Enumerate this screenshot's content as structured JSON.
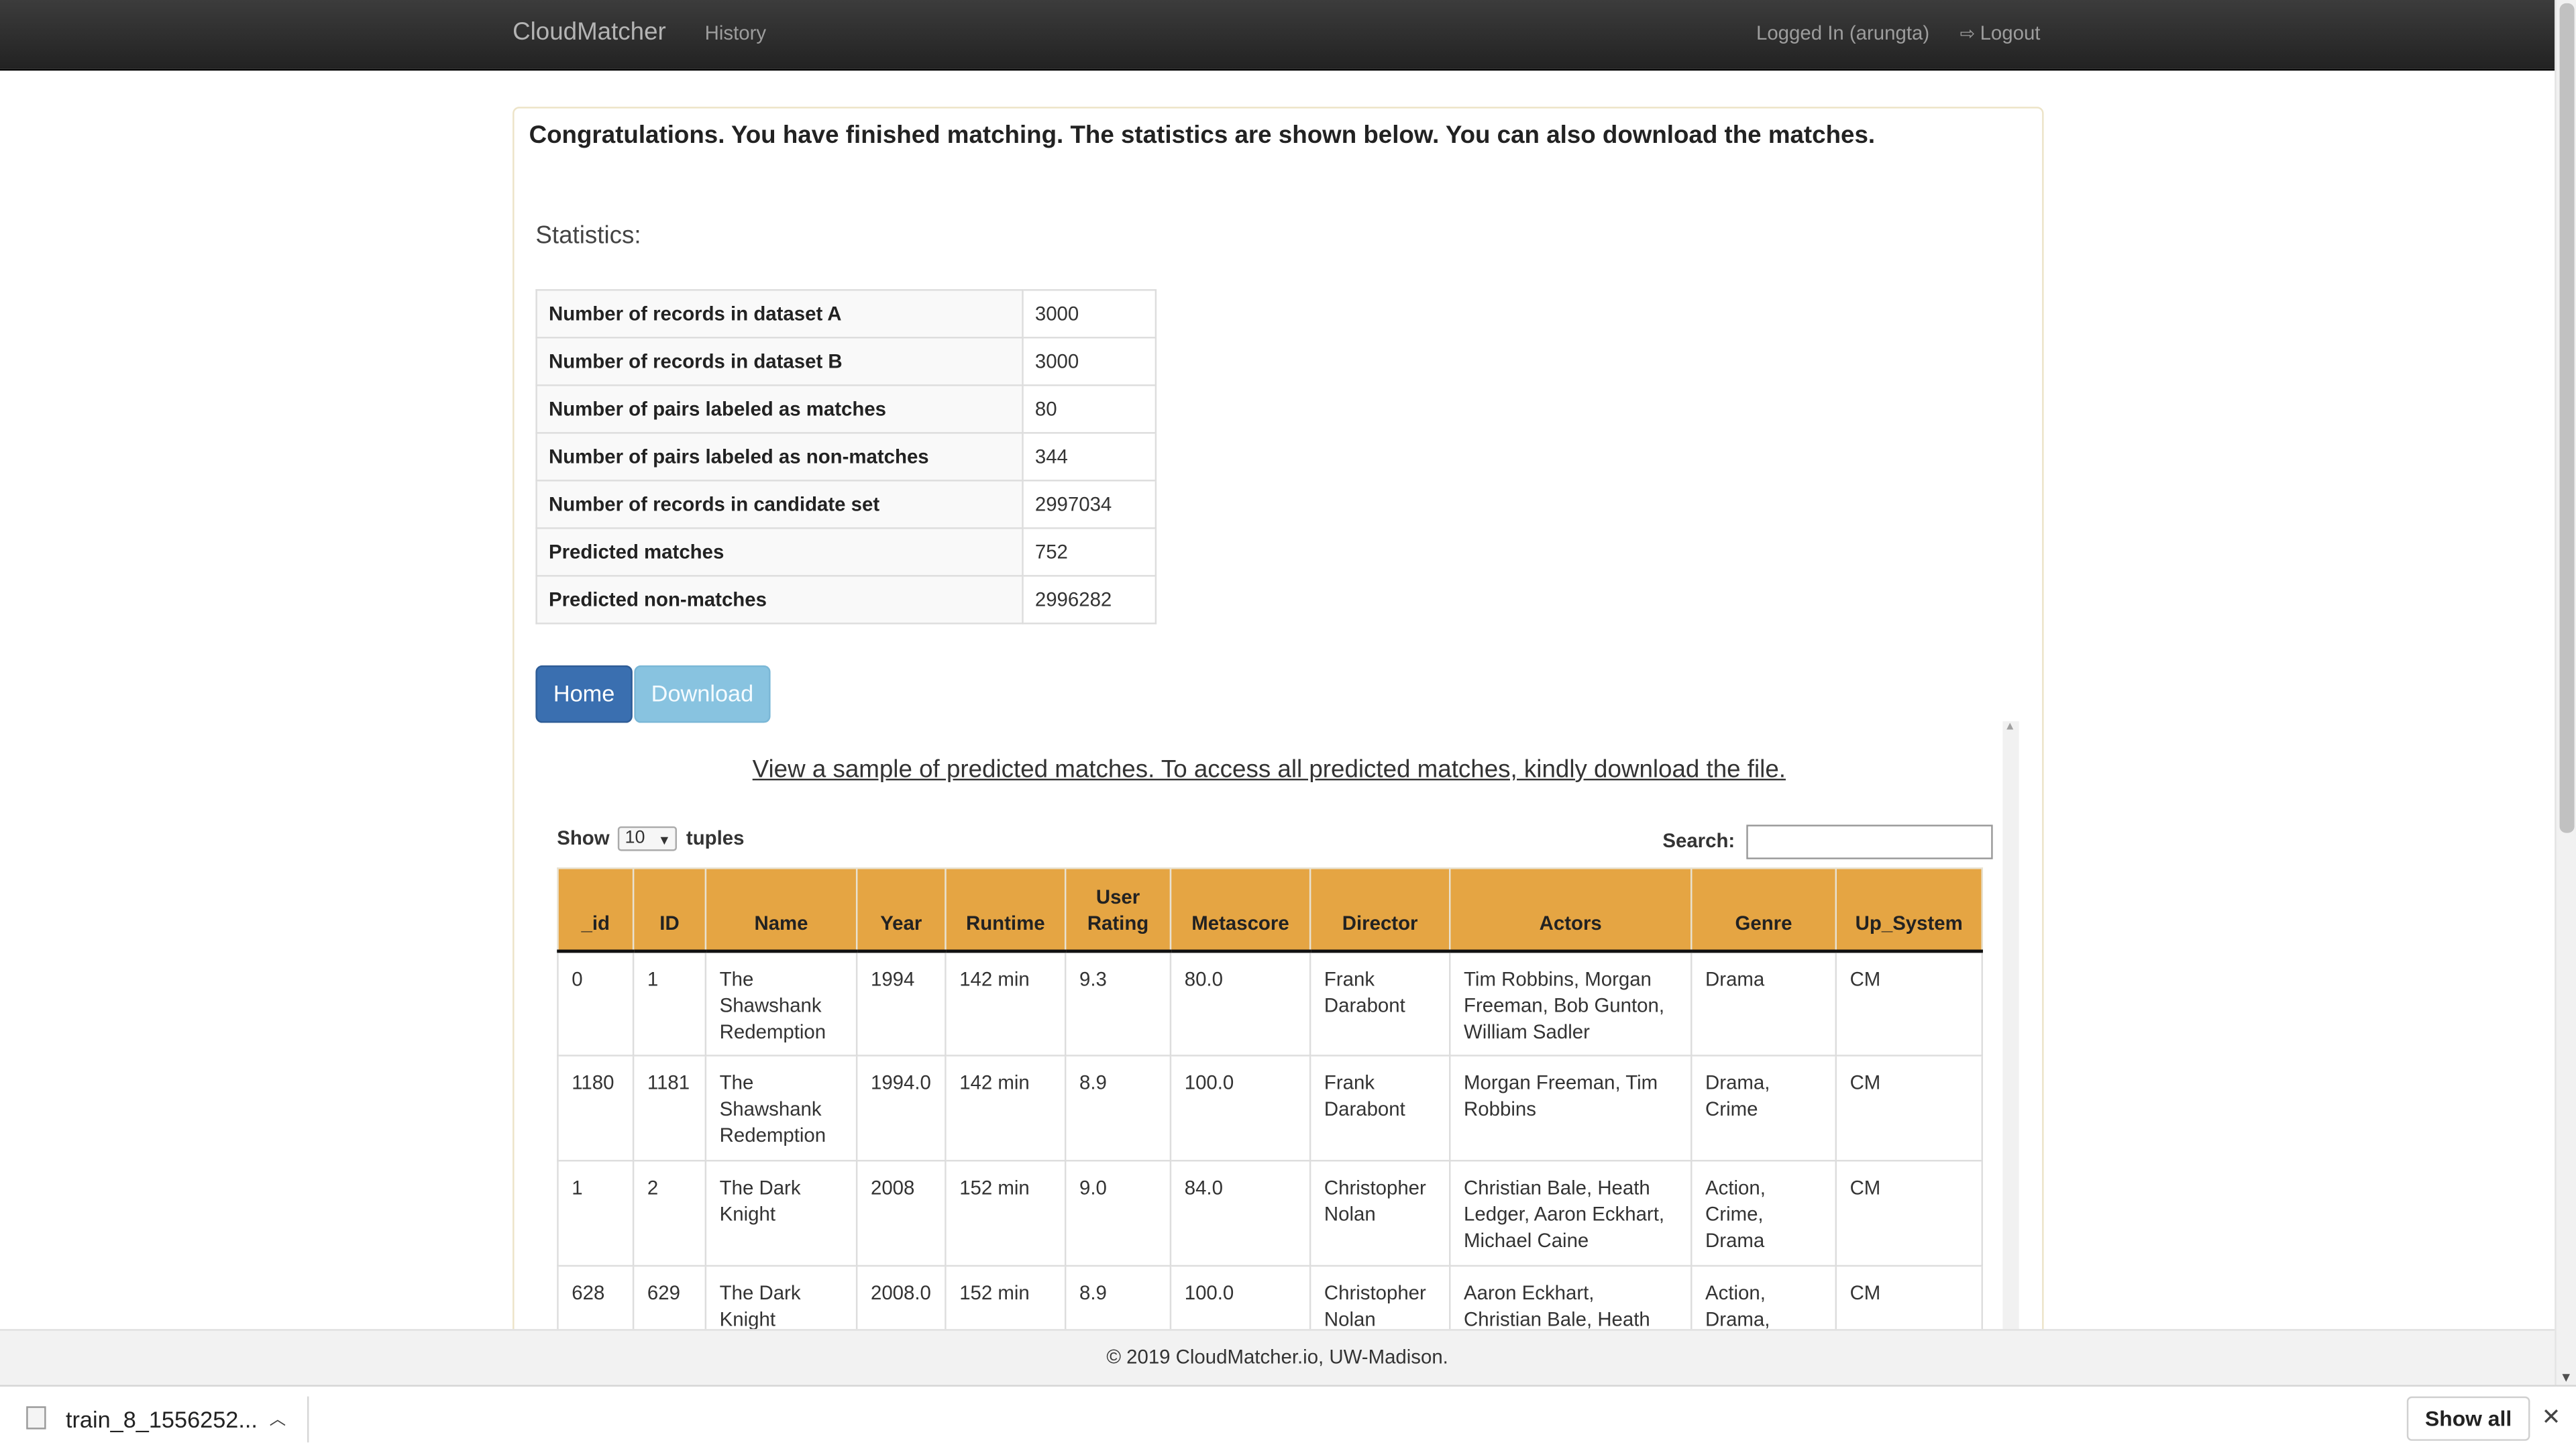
{
  "navbar": {
    "brand": "CloudMatcher",
    "history": "History",
    "logged_in": "Logged In (arungta)",
    "logout": "Logout",
    "logout_icon": "logout-icon"
  },
  "panel": {
    "congrats": "Congratulations. You have finished matching. The statistics are shown below. You can also download the matches.",
    "stats_title": "Statistics:",
    "stats": [
      {
        "label": "Number of records in dataset A",
        "value": "3000"
      },
      {
        "label": "Number of records in dataset B",
        "value": "3000"
      },
      {
        "label": "Number of pairs labeled as matches",
        "value": "80"
      },
      {
        "label": "Number of pairs labeled as non-matches",
        "value": "344"
      },
      {
        "label": "Number of records in candidate set",
        "value": "2997034"
      },
      {
        "label": "Predicted matches",
        "value": "752"
      },
      {
        "label": "Predicted non-matches",
        "value": "2996282"
      }
    ],
    "home_button": "Home",
    "download_button": "Download"
  },
  "sample": {
    "link_text": "View a sample of predicted matches. To access all predicted matches, kindly download the file.",
    "show_label": "Show",
    "show_value": "10",
    "tuples_label": "tuples",
    "search_label": "Search:",
    "search_value": "",
    "columns": [
      "_id",
      "ID",
      "Name",
      "Year",
      "Runtime",
      "User Rating",
      "Metascore",
      "Director",
      "Actors",
      "Genre",
      "Up_System"
    ],
    "rows": [
      [
        "0",
        "1",
        "The Shawshank Redemption",
        "1994",
        "142 min",
        "9.3",
        "80.0",
        "Frank Darabont",
        "Tim Robbins, Morgan Freeman, Bob Gunton, William Sadler",
        "Drama",
        "CM"
      ],
      [
        "1180",
        "1181",
        "The Shawshank Redemption",
        "1994.0",
        "142 min",
        "8.9",
        "100.0",
        "Frank Darabont",
        "Morgan Freeman, Tim Robbins",
        "Drama, Crime",
        "CM"
      ],
      [
        "1",
        "2",
        "The Dark Knight",
        "2008",
        "152 min",
        "9.0",
        "84.0",
        "Christopher Nolan",
        "Christian Bale, Heath Ledger, Aaron Eckhart, Michael Caine",
        "Action, Crime, Drama",
        "CM"
      ],
      [
        "628",
        "629",
        "The Dark Knight",
        "2008.0",
        "152 min",
        "8.9",
        "100.0",
        "Christopher Nolan",
        "Aaron Eckhart, Christian Bale, Heath Ledger",
        "Action, Drama,",
        "CM"
      ]
    ]
  },
  "footer": {
    "text": "© 2019 CloudMatcher.io, UW-Madison."
  },
  "download_shelf": {
    "file_name": "train_8_1556252...",
    "file_icon": "file-icon",
    "show_all": "Show all",
    "close": "✕"
  }
}
